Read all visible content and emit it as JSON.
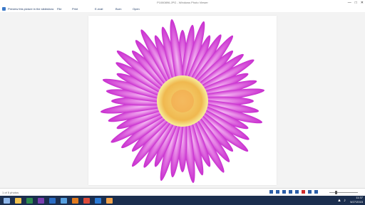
{
  "window": {
    "title": "P1080896.JPG - Windows Photo Viewer",
    "controls": [
      "minimize",
      "restore",
      "close"
    ]
  },
  "menu": {
    "items": [
      "Preview this picture in the slideshow",
      "File",
      "Print",
      "E-mail",
      "Burn",
      "Open"
    ]
  },
  "viewer": {
    "status": "1 of 5 photos"
  },
  "taskbar": {
    "apps": [
      "start",
      "file-explorer",
      "excel",
      "onenote",
      "outlook",
      "network",
      "firefox",
      "chrome",
      "ie",
      "photo-viewer"
    ]
  },
  "clock": {
    "time": "11:37",
    "date": "5/27/2015"
  },
  "colors": {
    "petal": "#d64ed6",
    "petal_light": "#f3b6f2",
    "center": "#f2c05a"
  }
}
